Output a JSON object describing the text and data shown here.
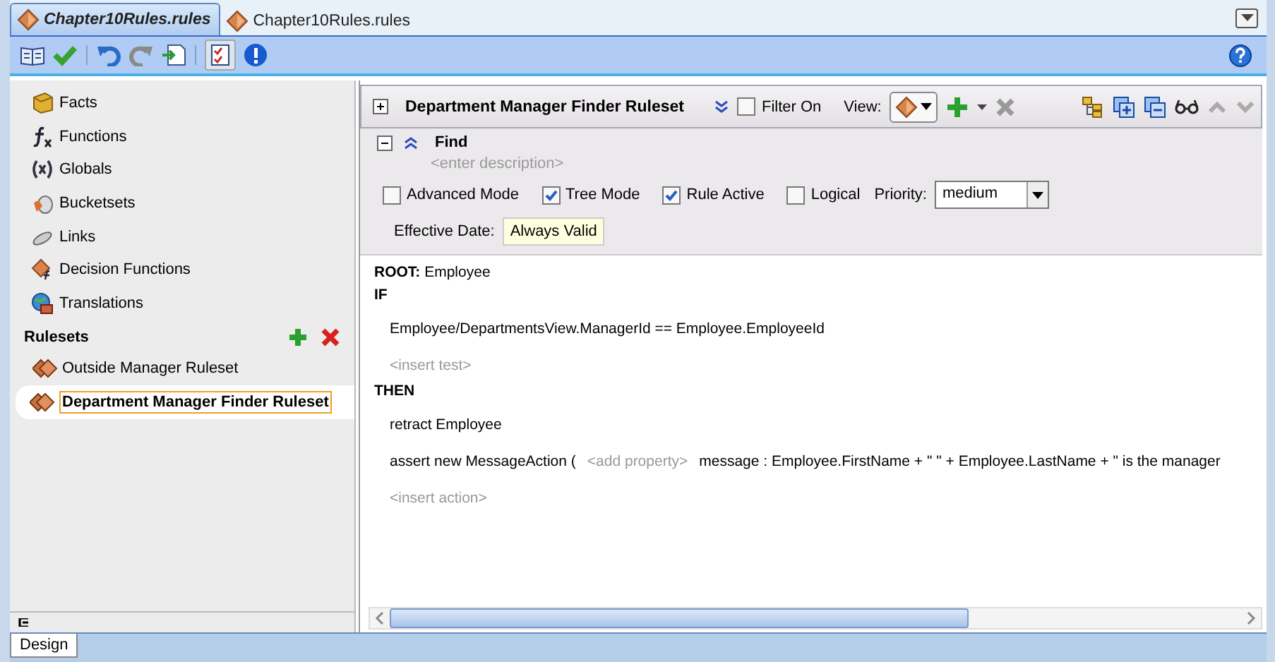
{
  "document_tabs": [
    {
      "label": "Chapter10Rules.rules",
      "selected": true
    },
    {
      "label": "Chapter10Rules.rules",
      "selected": false
    }
  ],
  "sidebar": {
    "items": [
      {
        "label": "Facts",
        "kind": "facts"
      },
      {
        "label": "Functions",
        "kind": "functions"
      },
      {
        "label": "Globals",
        "kind": "globals"
      },
      {
        "label": "Bucketsets",
        "kind": "bucketsets"
      },
      {
        "label": "Links",
        "kind": "links"
      },
      {
        "label": "Decision Functions",
        "kind": "decision"
      },
      {
        "label": "Translations",
        "kind": "translations"
      }
    ],
    "rulesets_title": "Rulesets",
    "rulesets": [
      {
        "label": "Outside Manager Ruleset",
        "selected": false
      },
      {
        "label": "Department Manager Finder Ruleset",
        "selected": true
      }
    ]
  },
  "ruleset": {
    "title": "Department Manager Finder Ruleset",
    "filter": {
      "label": "Filter On",
      "checked": false
    },
    "view_label": "View:"
  },
  "rule": {
    "name": "Find",
    "description_placeholder": "<enter description>",
    "options": [
      {
        "label": "Advanced Mode",
        "checked": false
      },
      {
        "label": "Tree Mode",
        "checked": true
      },
      {
        "label": "Rule Active",
        "checked": true
      },
      {
        "label": "Logical",
        "checked": false
      }
    ],
    "priority_label": "Priority:",
    "priority": "medium",
    "effective_date_label": "Effective Date:",
    "effective_date": "Always Valid"
  },
  "rule_body": [
    {
      "kind": "root",
      "text": "**ROOT:** Employee"
    },
    {
      "kind": "keyword",
      "text": "IF"
    },
    {
      "kind": "line",
      "parts": [
        {
          "kind": "code",
          "text": "Employee/DepartmentsView.ManagerId  ==  Employee.EmployeeId"
        }
      ]
    },
    {
      "kind": "line",
      "parts": [
        {
          "kind": "hint",
          "text": "<insert test>"
        }
      ]
    },
    {
      "kind": "keyword",
      "text": "THEN"
    },
    {
      "kind": "line",
      "parts": [
        {
          "kind": "code",
          "text": "retract Employee"
        }
      ]
    },
    {
      "kind": "line",
      "parts": [
        {
          "kind": "code",
          "text": "assert new MessageAction ("
        },
        {
          "kind": "hint",
          "text": "<add property>"
        },
        {
          "kind": "code",
          "text": "message : Employee.FirstName + \" \" + Employee.LastName + \" is the manager"
        }
      ]
    },
    {
      "kind": "line",
      "parts": [
        {
          "kind": "hint",
          "text": "<insert action>"
        }
      ]
    }
  ],
  "bottom_tabs": [
    "Design"
  ]
}
